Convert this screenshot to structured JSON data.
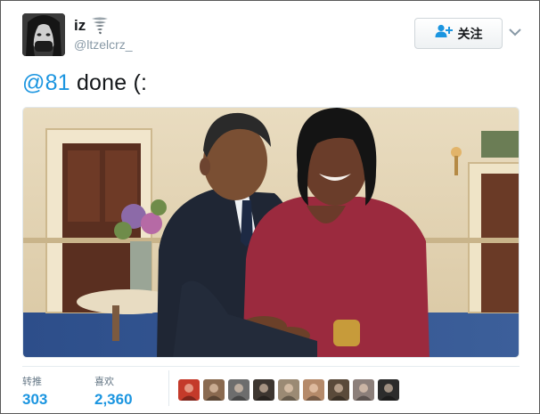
{
  "user": {
    "display_name": "iz",
    "emoji_icon": "tornado-icon",
    "handle": "@ltzelcrz_"
  },
  "follow_button": {
    "label": "关注",
    "icon": "follow-person-plus-icon"
  },
  "menu_caret": {
    "icon": "chevron-down-icon"
  },
  "tweet": {
    "mention": "@81",
    "text": " done (:"
  },
  "media": {
    "alt": "Photo of a couple embracing in a decorated room"
  },
  "stats": {
    "retweets_label": "转推",
    "retweets_value": "303",
    "likes_label": "喜欢",
    "likes_value": "2,360"
  },
  "likers": [
    {
      "name": "liker-avatar-1",
      "color": "#c43a2a"
    },
    {
      "name": "liker-avatar-2",
      "color": "#8a6a50"
    },
    {
      "name": "liker-avatar-3",
      "color": "#6d6d6d"
    },
    {
      "name": "liker-avatar-4",
      "color": "#3d3630"
    },
    {
      "name": "liker-avatar-5",
      "color": "#9b8a74"
    },
    {
      "name": "liker-avatar-6",
      "color": "#b58a6a"
    },
    {
      "name": "liker-avatar-7",
      "color": "#5a4a3a"
    },
    {
      "name": "liker-avatar-8",
      "color": "#8c7f7a"
    },
    {
      "name": "liker-avatar-9",
      "color": "#2c2c2c"
    }
  ],
  "colors": {
    "link_blue": "#1b95e0",
    "muted_gray": "#8899a6",
    "text_dark": "#14171a"
  }
}
